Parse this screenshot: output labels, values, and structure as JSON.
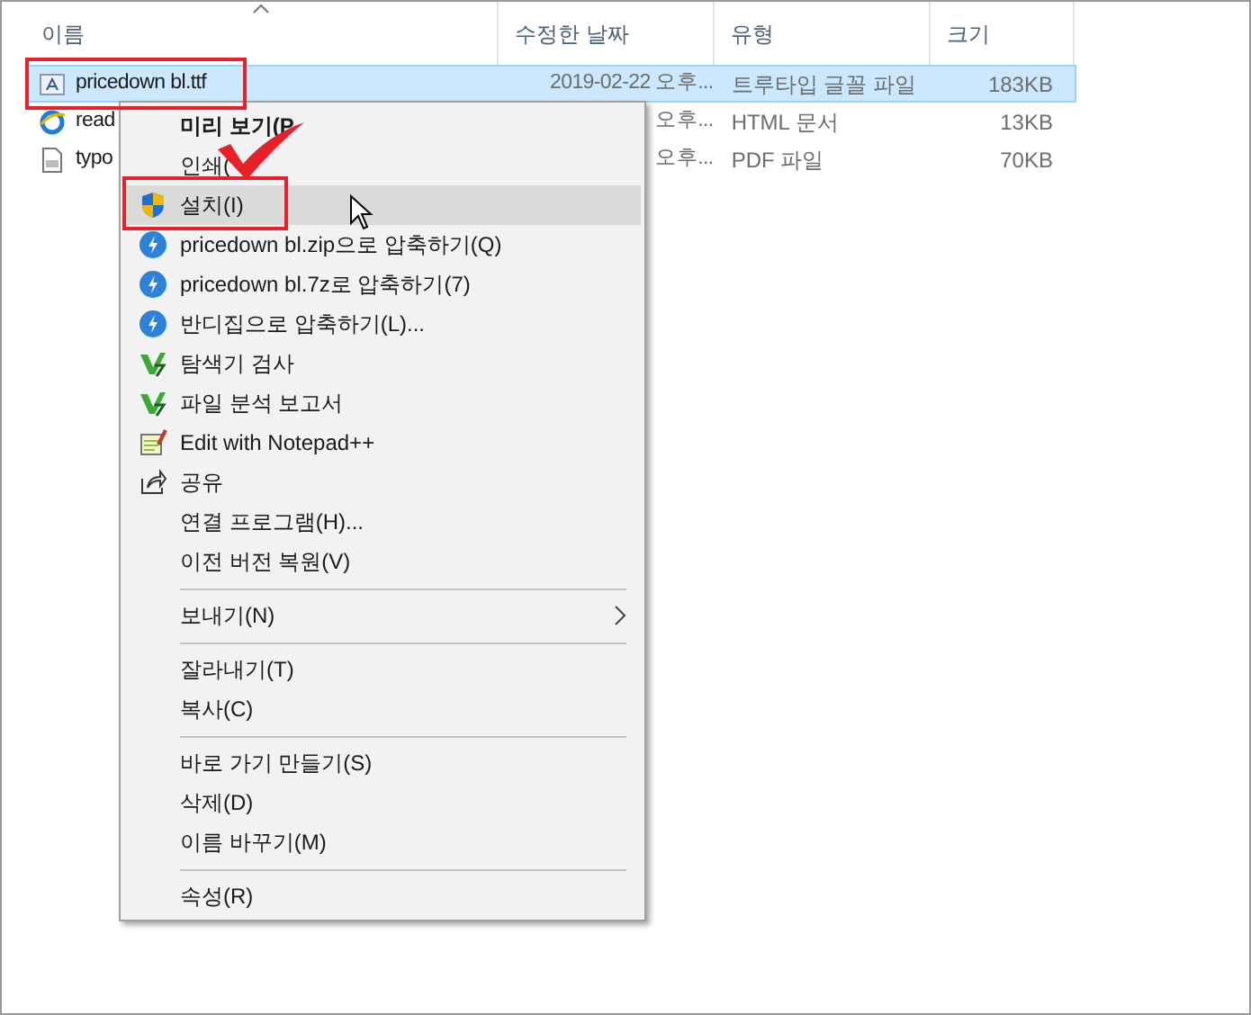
{
  "columns": [
    {
      "label": "이름",
      "sorted": true
    },
    {
      "label": "수정한 날짜",
      "sorted": false
    },
    {
      "label": "유형",
      "sorted": false
    },
    {
      "label": "크기",
      "sorted": false
    }
  ],
  "files": [
    {
      "kind": "font",
      "name": "pricedown bl.ttf",
      "date": "2019-02-22 오후...",
      "type": "트루타입 글꼴 파일",
      "size": "183KB",
      "selected": true
    },
    {
      "kind": "web",
      "name": "read",
      "date": "오후...",
      "type": "HTML 문서",
      "size": "13KB",
      "selected": false
    },
    {
      "kind": "pdf",
      "name": "typo",
      "date": "오후...",
      "type": "PDF 파일",
      "size": "70KB",
      "selected": false
    }
  ],
  "context_menu": [
    {
      "kind": "plain",
      "label": "미리 보기(P",
      "default": true,
      "selected": false,
      "submenu": false
    },
    {
      "kind": "plain",
      "label": "인쇄(",
      "default": false,
      "selected": false,
      "submenu": false
    },
    {
      "kind": "install",
      "label": "설치(I)",
      "default": false,
      "selected": true,
      "submenu": false
    },
    {
      "kind": "compress",
      "label": "pricedown bl.zip으로 압축하기(Q)",
      "default": false,
      "selected": false,
      "submenu": false
    },
    {
      "kind": "compress",
      "label": "pricedown bl.7z로 압축하기(7)",
      "default": false,
      "selected": false,
      "submenu": false
    },
    {
      "kind": "compress",
      "label": "반디집으로 압축하기(L)...",
      "default": false,
      "selected": false,
      "submenu": false
    },
    {
      "kind": "scan",
      "label": "탐색기 검사",
      "default": false,
      "selected": false,
      "submenu": false
    },
    {
      "kind": "scan",
      "label": "파일 분석 보고서",
      "default": false,
      "selected": false,
      "submenu": false
    },
    {
      "kind": "notepad",
      "label": "Edit with Notepad++",
      "default": false,
      "selected": false,
      "submenu": false
    },
    {
      "kind": "share",
      "label": "공유",
      "default": false,
      "selected": false,
      "submenu": false
    },
    {
      "kind": "plain",
      "label": "연결 프로그램(H)...",
      "default": false,
      "selected": false,
      "submenu": false
    },
    {
      "kind": "plain",
      "label": "이전 버전 복원(V)",
      "default": false,
      "selected": false,
      "submenu": false
    },
    {
      "kind": "separator"
    },
    {
      "kind": "plain",
      "label": "보내기(N)",
      "default": false,
      "selected": false,
      "submenu": true
    },
    {
      "kind": "separator"
    },
    {
      "kind": "plain",
      "label": "잘라내기(T)",
      "default": false,
      "selected": false,
      "submenu": false
    },
    {
      "kind": "plain",
      "label": "복사(C)",
      "default": false,
      "selected": false,
      "submenu": false
    },
    {
      "kind": "separator"
    },
    {
      "kind": "plain",
      "label": "바로 가기 만들기(S)",
      "default": false,
      "selected": false,
      "submenu": false
    },
    {
      "kind": "plain",
      "label": "삭제(D)",
      "default": false,
      "selected": false,
      "submenu": false
    },
    {
      "kind": "plain",
      "label": "이름 바꾸기(M)",
      "default": false,
      "selected": false,
      "submenu": false
    },
    {
      "kind": "separator"
    },
    {
      "kind": "plain",
      "label": "속성(R)",
      "default": false,
      "selected": false,
      "submenu": false
    }
  ]
}
